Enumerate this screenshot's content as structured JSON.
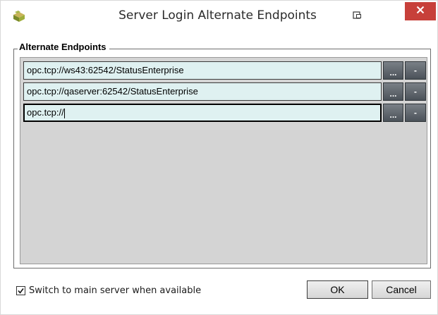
{
  "window": {
    "title": "Server Login Alternate Endpoints",
    "icons": {
      "app": "app-icon",
      "pin": "pin-icon",
      "close": "close-icon"
    }
  },
  "group": {
    "label": "Alternate Endpoints"
  },
  "endpoints": [
    {
      "value": "opc.tcp://ws43:62542/StatusEnterprise",
      "browse_label": "...",
      "remove_label": "-"
    },
    {
      "value": "opc.tcp://qaserver:62542/StatusEnterprise",
      "browse_label": "...",
      "remove_label": "-"
    },
    {
      "value": "opc.tcp://",
      "browse_label": "...",
      "remove_label": "-",
      "focused": true
    }
  ],
  "options": {
    "switch_to_main": {
      "label": "Switch to main server when available",
      "checked": true
    }
  },
  "buttons": {
    "ok": "OK",
    "cancel": "Cancel"
  },
  "colors": {
    "close_bg": "#c7403a",
    "field_bg": "#dff1f1",
    "list_bg": "#d4d4d4",
    "action_btn": "#5a6168"
  }
}
